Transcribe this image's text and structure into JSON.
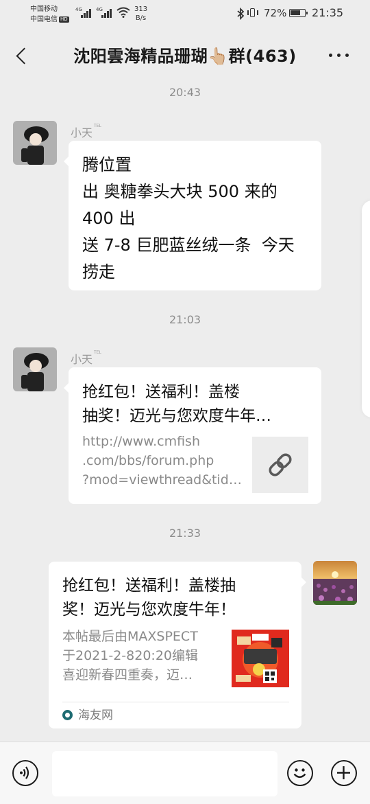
{
  "status_bar": {
    "carrier1": "中国移动",
    "carrier2": "中国电信",
    "hd_badge": "HD",
    "net_type1": "4G",
    "net_type2": "4G",
    "speed_value": "313",
    "speed_unit": "B/s",
    "battery_percent": "72%",
    "battery_level": 0.72,
    "time": "21:35"
  },
  "header": {
    "title": "沈阳雲海精品珊瑚👆🏼群(463)"
  },
  "messages": [
    {
      "timestamp": "20:43",
      "sender": "小天",
      "sender_badge": "TEL",
      "text": "腾位置\n出 奥糖拳头大块 500 来的\n400 出\n送 7-8 巨肥蓝丝绒一条  今天\n捞走"
    },
    {
      "timestamp": "21:03",
      "sender": "小天",
      "sender_badge": "TEL",
      "card_title": [
        "抢红包！送福利！盖楼",
        "抽奖！迈光与您欢度牛年…"
      ],
      "card_desc": [
        "http://www.cmfish",
        ".com/bbs/forum.php",
        "?mod=viewthread&tid…"
      ],
      "thumb_icon": "link-icon"
    },
    {
      "timestamp": "21:33",
      "card_title": [
        "抢红包！送福利！盖楼抽",
        "奖！迈光与您欢度牛年！"
      ],
      "card_desc": [
        "本帖最后由MAXSPECT",
        "于2021-2-820:20编辑",
        "喜迎新春四重奏，迈…"
      ],
      "source": "海友网"
    }
  ],
  "input_bar": {
    "voice_icon": "voice-icon",
    "emoji_icon": "emoji-icon",
    "plus_icon": "plus-icon"
  },
  "colors": {
    "background": "#ededed",
    "bubble": "#ffffff",
    "timestamp": "#8c8c8c",
    "source_icon": "#1e6b72"
  }
}
